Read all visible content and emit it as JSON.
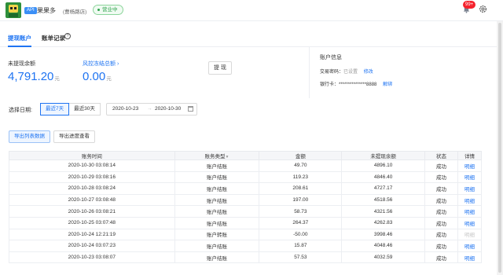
{
  "header": {
    "api_badge": "API",
    "shop_name": "果果多",
    "shop_branch": "(曹杨路店)",
    "status": "营业中",
    "notification_count": "99+"
  },
  "tabs": [
    {
      "label": "提现账户",
      "active": true
    },
    {
      "label": "账单记录",
      "active": false
    }
  ],
  "balance": {
    "unwithdrawn_label": "未提现余额",
    "unwithdrawn_value": "4,791.20",
    "unit": "元",
    "frozen_label": "风控冻结总额 ›",
    "frozen_value": "0.00",
    "withdraw_button": "提 现"
  },
  "account": {
    "title": "账户信息",
    "password_label": "交易密码：",
    "password_status": "已设置",
    "password_action": "修改",
    "card_label": "银行卡：",
    "card_number": "***************8888",
    "card_action": "解绑"
  },
  "filter": {
    "date_label": "选择日期:",
    "options": [
      "最近7天",
      "最近30天"
    ],
    "active_option": 0,
    "start_date": "2020-10-23",
    "range_sep": "→",
    "end_date": "2020-10-30"
  },
  "actions": {
    "export_list": "导出列表数据",
    "export_progress": "导出进度查看"
  },
  "table": {
    "headers": [
      "账务时间",
      "账务类型",
      "金额",
      "未提现余额",
      "状态",
      "详情"
    ],
    "rows": [
      {
        "time": "2020-10-30 03:08:14",
        "type": "账户结账",
        "amount": "49.70",
        "balance": "4896.10",
        "status": "成功",
        "detail": "明细"
      },
      {
        "time": "2020-10-29 03:08:16",
        "type": "账户结账",
        "amount": "119.23",
        "balance": "4846.40",
        "status": "成功",
        "detail": "明细"
      },
      {
        "time": "2020-10-28 03:08:24",
        "type": "账户结账",
        "amount": "208.61",
        "balance": "4727.17",
        "status": "成功",
        "detail": "明细"
      },
      {
        "time": "2020-10-27 03:08:48",
        "type": "账户结账",
        "amount": "197.00",
        "balance": "4518.56",
        "status": "成功",
        "detail": "明细"
      },
      {
        "time": "2020-10-26 03:08:21",
        "type": "账户结账",
        "amount": "58.73",
        "balance": "4321.56",
        "status": "成功",
        "detail": "明细"
      },
      {
        "time": "2020-10-25 03:07:48",
        "type": "账户结账",
        "amount": "264.37",
        "balance": "4262.83",
        "status": "成功",
        "detail": "明细"
      },
      {
        "time": "2020-10-24 12:21:19",
        "type": "账户转账",
        "amount": "-50.00",
        "balance": "3998.46",
        "status": "成功",
        "detail": "明细"
      },
      {
        "time": "2020-10-24 03:07:23",
        "type": "账户结账",
        "amount": "15.87",
        "balance": "4048.46",
        "status": "成功",
        "detail": "明细"
      },
      {
        "time": "2020-10-23 03:08:07",
        "type": "账户结账",
        "amount": "57.53",
        "balance": "4032.59",
        "status": "成功",
        "detail": "明细"
      }
    ]
  },
  "colors": {
    "accent": "#1f74f2",
    "status_green": "#2da24b",
    "badge_red": "#f5222d"
  }
}
